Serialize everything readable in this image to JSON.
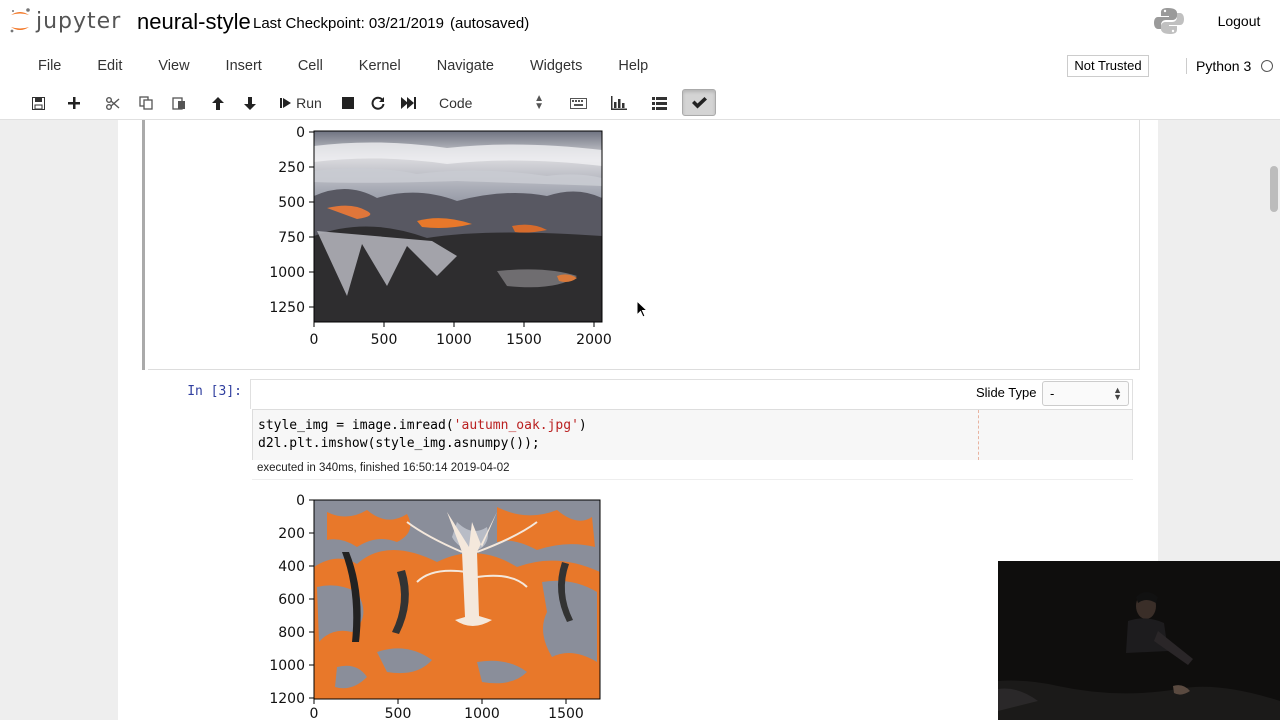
{
  "header": {
    "logo_text": "jupyter",
    "notebook_name": "neural-style",
    "checkpoint": "Last Checkpoint: 03/21/2019",
    "autosave_status": "(autosaved)",
    "logout_label": "Logout",
    "trust_status": "Not Trusted",
    "kernel_name": "Python 3"
  },
  "menubar": {
    "items": [
      "File",
      "Edit",
      "View",
      "Insert",
      "Cell",
      "Kernel",
      "Navigate",
      "Widgets",
      "Help"
    ]
  },
  "toolbar": {
    "run_label": "Run",
    "cell_type": "Code",
    "icons": [
      "save-icon",
      "plus-icon",
      "cut-icon",
      "copy-icon",
      "paste-icon",
      "arrow-up-icon",
      "arrow-down-icon",
      "run-icon",
      "stop-icon",
      "restart-icon",
      "fast-forward-icon",
      "keyboard-icon",
      "bar-chart-icon",
      "list-icon",
      "checkmark-icon"
    ]
  },
  "output_plot_1": {
    "yticks": [
      "0",
      "250",
      "500",
      "750",
      "1000",
      "1250"
    ],
    "xticks": [
      "0",
      "500",
      "1000",
      "1500",
      "2000"
    ]
  },
  "cell_3": {
    "prompt": "In [3]:",
    "slide_type_label": "Slide Type",
    "slide_type_value": "-",
    "code_line_1_prefix": "style_img = image.imread(",
    "code_line_1_string": "'autumn_oak.jpg'",
    "code_line_1_suffix": ")",
    "code_line_2": "d2l.plt.imshow(style_img.asnumpy());",
    "execution_info": "executed in 340ms, finished 16:50:14 2019-04-02"
  },
  "output_plot_2": {
    "yticks": [
      "0",
      "200",
      "400",
      "600",
      "800",
      "1000",
      "1200"
    ],
    "xticks": [
      "0",
      "500",
      "1000",
      "1500"
    ]
  },
  "colors": {
    "prompt_blue": "#303f9f",
    "string_red": "#ba2121",
    "autumn_orange": "#e8782a",
    "sky_gray": "#8a8e9a"
  }
}
